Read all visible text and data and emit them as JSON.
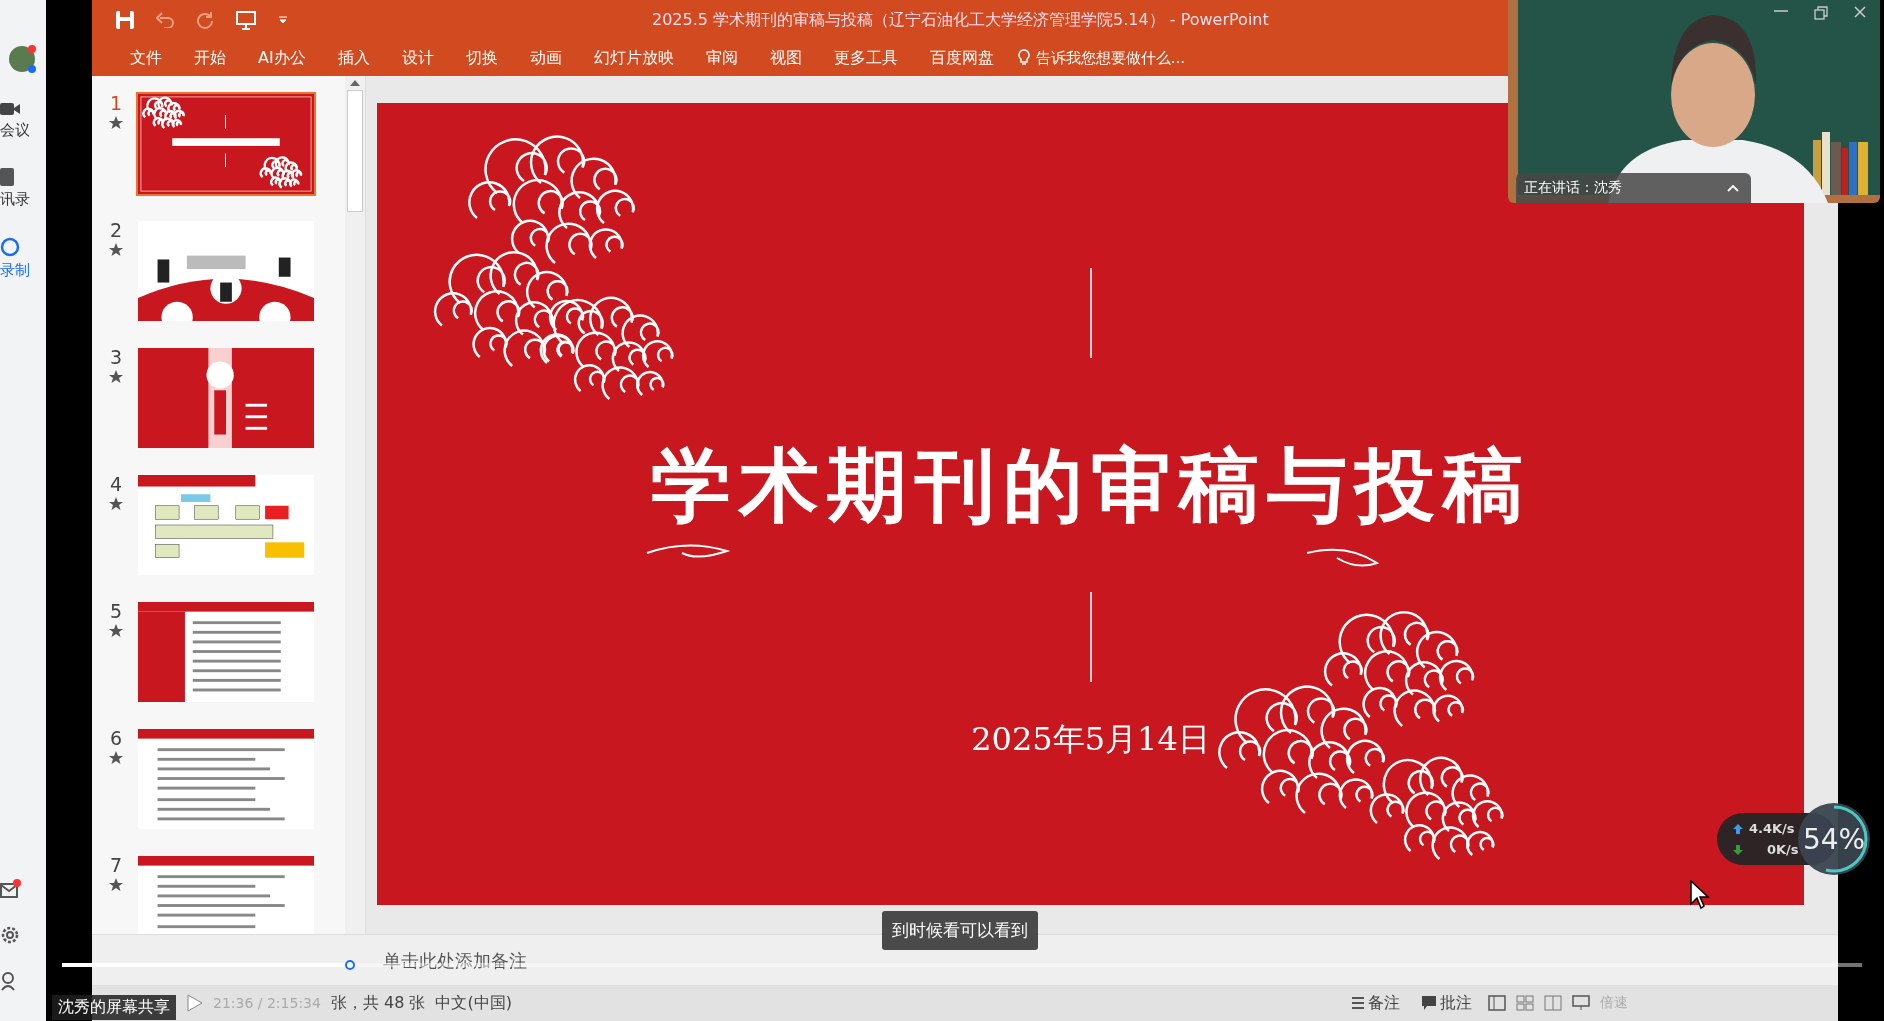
{
  "meeting_sidebar": {
    "items": [
      {
        "label": "会议",
        "kind": "camera",
        "selected": false
      },
      {
        "label": "讯录",
        "kind": "contacts",
        "selected": false
      },
      {
        "label": "录制",
        "kind": "record",
        "selected": true
      }
    ]
  },
  "window": {
    "title": "2025.5 学术期刊的审稿与投稿（辽宁石油化工大学经济管理学院5.14） - PowerPoint"
  },
  "ribbon": {
    "tabs": [
      "文件",
      "开始",
      "AI办公",
      "插入",
      "设计",
      "切换",
      "动画",
      "幻灯片放映",
      "审阅",
      "视图",
      "更多工具",
      "百度网盘"
    ],
    "tell_me": {
      "placeholder": "告诉我您想要做什么..."
    }
  },
  "thumbnails": [
    {
      "number": "1",
      "kind": "title",
      "selected": true
    },
    {
      "number": "2",
      "kind": "bridge",
      "selected": false
    },
    {
      "number": "3",
      "kind": "section",
      "selected": false
    },
    {
      "number": "4",
      "kind": "diagram",
      "selected": false
    },
    {
      "number": "5",
      "kind": "text",
      "selected": false
    },
    {
      "number": "6",
      "kind": "list",
      "selected": false
    },
    {
      "number": "7",
      "kind": "list",
      "selected": false
    }
  ],
  "slide": {
    "title": "学术期刊的审稿与投稿",
    "date": "2025年5月14日"
  },
  "notes": {
    "placeholder": "单击此处添加备注"
  },
  "subtitle": "到时候看可以看到",
  "webcam": {
    "speaker": "正在讲话：沈秀"
  },
  "network": {
    "upload": "4.4K/s",
    "download": "0K/s",
    "usage": "54%",
    "level": 0.54
  },
  "player": {
    "level": 0.16,
    "time": "21:36 / 2:15:34",
    "share_label": "沈秀的屏幕共享"
  },
  "status_bar": {
    "slide_count": "张，共 48 张",
    "language": "中文(中国)",
    "notes_button": "备注",
    "comments_button": "批注",
    "speed": "倍速"
  }
}
